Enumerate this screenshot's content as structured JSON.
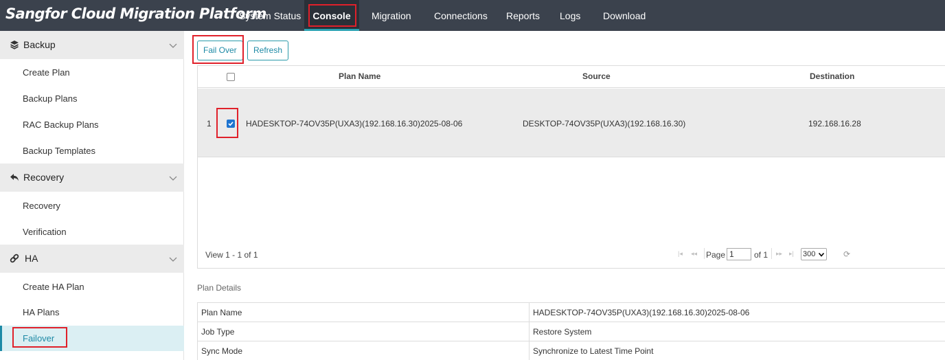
{
  "app": {
    "title": "Sangfor Cloud Migration Platform"
  },
  "nav": {
    "tabs": [
      {
        "label": "System Status"
      },
      {
        "label": "Console",
        "active": true
      },
      {
        "label": "Migration"
      },
      {
        "label": "Connections"
      },
      {
        "label": "Reports"
      },
      {
        "label": "Logs"
      },
      {
        "label": "Download"
      }
    ]
  },
  "sidebar": {
    "sections": [
      {
        "label": "Backup",
        "icon": "layers-icon",
        "items": [
          "Create Plan",
          "Backup Plans",
          "RAC Backup Plans",
          "Backup Templates"
        ]
      },
      {
        "label": "Recovery",
        "icon": "undo-icon",
        "items": [
          "Recovery",
          "Verification"
        ]
      },
      {
        "label": "HA",
        "icon": "link-icon",
        "items": [
          "Create HA Plan",
          "HA Plans",
          "Failover"
        ]
      }
    ],
    "active_item": "Failover"
  },
  "toolbar": {
    "failover_label": "Fail Over",
    "refresh_label": "Refresh"
  },
  "grid": {
    "columns": [
      "Plan Name",
      "Source",
      "Destination"
    ],
    "rows": [
      {
        "index": "1",
        "checked": true,
        "plan_name": "HADESKTOP-74OV35P(UXA3)(192.168.16.30)2025-08-06",
        "source": "DESKTOP-74OV35P(UXA3)(192.168.16.30)",
        "destination": "192.168.16.28"
      }
    ],
    "pager": {
      "view_text": "View 1 - 1 of 1",
      "page_label": "Page",
      "page_value": "1",
      "of_text": "of 1",
      "page_size": "300"
    }
  },
  "details": {
    "title": "Plan Details",
    "rows": [
      {
        "key": "Plan Name",
        "value": "HADESKTOP-74OV35P(UXA3)(192.168.16.30)2025-08-06"
      },
      {
        "key": "Job Type",
        "value": "Restore System"
      },
      {
        "key": "Sync Mode",
        "value": "Synchronize to Latest Time Point"
      }
    ]
  },
  "colors": {
    "topbar": "#3b424d",
    "accent": "#1e8aa6",
    "highlight": "#e0202a"
  }
}
